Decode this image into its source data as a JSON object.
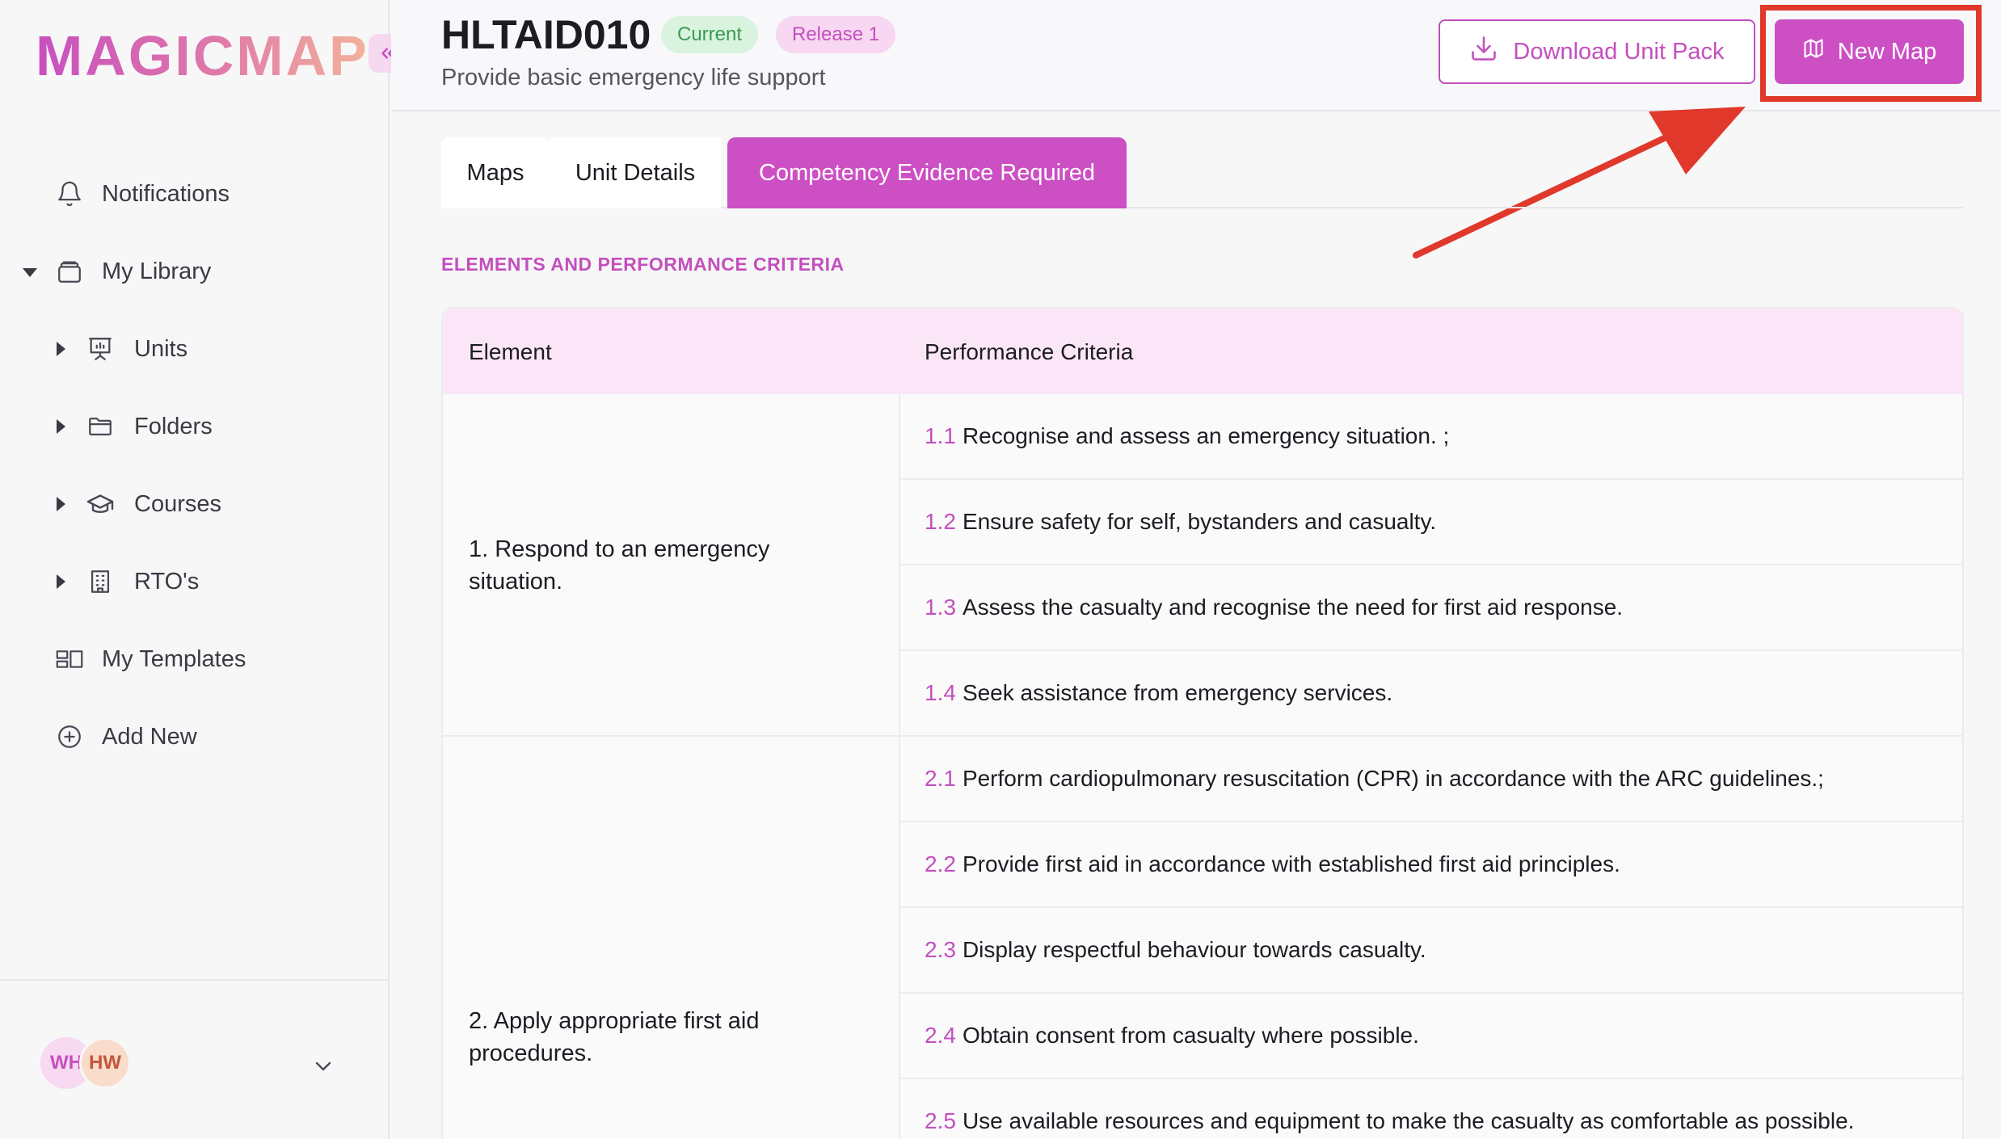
{
  "brand": {
    "logo_text": "MAGICMAP"
  },
  "sidebar": {
    "items": [
      {
        "label": "Notifications",
        "icon": "bell-icon"
      },
      {
        "label": "My Library",
        "icon": "library-icon"
      },
      {
        "label": "Units",
        "icon": "presentation-icon"
      },
      {
        "label": "Folders",
        "icon": "folder-icon"
      },
      {
        "label": "Courses",
        "icon": "graduation-cap-icon"
      },
      {
        "label": "RTO's",
        "icon": "building-icon"
      },
      {
        "label": "My Templates",
        "icon": "templates-icon"
      },
      {
        "label": "Add New",
        "icon": "plus-circle-icon"
      }
    ],
    "user": {
      "avatar1": "WH",
      "avatar2": "HW"
    }
  },
  "header": {
    "unit_code": "HLTAID010",
    "status_badge": "Current",
    "release_badge": "Release 1",
    "unit_title": "Provide basic emergency life support",
    "download_label": "Download Unit Pack",
    "new_map_label": "New Map"
  },
  "tabs": [
    {
      "label": "Maps",
      "active": false
    },
    {
      "label": "Unit Details",
      "active": false
    },
    {
      "label": "Competency Evidence Required",
      "active": true
    }
  ],
  "section_title": "ELEMENTS AND PERFORMANCE CRITERIA",
  "table": {
    "headers": [
      "Element",
      "Performance Criteria"
    ],
    "elements": [
      {
        "label": "1. Respond to an emergency situation.",
        "criteria": [
          {
            "num": "1.1",
            "text": "Recognise and assess an emergency situation. ;"
          },
          {
            "num": "1.2",
            "text": "Ensure safety for self, bystanders and casualty."
          },
          {
            "num": "1.3",
            "text": "Assess the casualty and recognise the need for first aid response."
          },
          {
            "num": "1.4",
            "text": "Seek assistance from emergency services."
          }
        ]
      },
      {
        "label": "2. Apply appropriate first aid procedures.",
        "criteria": [
          {
            "num": "2.1",
            "text": "Perform cardiopulmonary resuscitation (CPR) in accordance with the ARC guidelines.;"
          },
          {
            "num": "2.2",
            "text": "Provide first aid in accordance with established first aid principles."
          },
          {
            "num": "2.3",
            "text": "Display respectful behaviour towards casualty."
          },
          {
            "num": "2.4",
            "text": "Obtain consent from casualty where possible."
          },
          {
            "num": "2.5",
            "text": "Use available resources and equipment to make the casualty as comfortable as possible."
          }
        ]
      }
    ]
  },
  "colors": {
    "accent": "#cc4fc4",
    "annotation": "#e0392b",
    "current_badge_bg": "#daf3df",
    "release_badge_bg": "#f8d7f2"
  }
}
